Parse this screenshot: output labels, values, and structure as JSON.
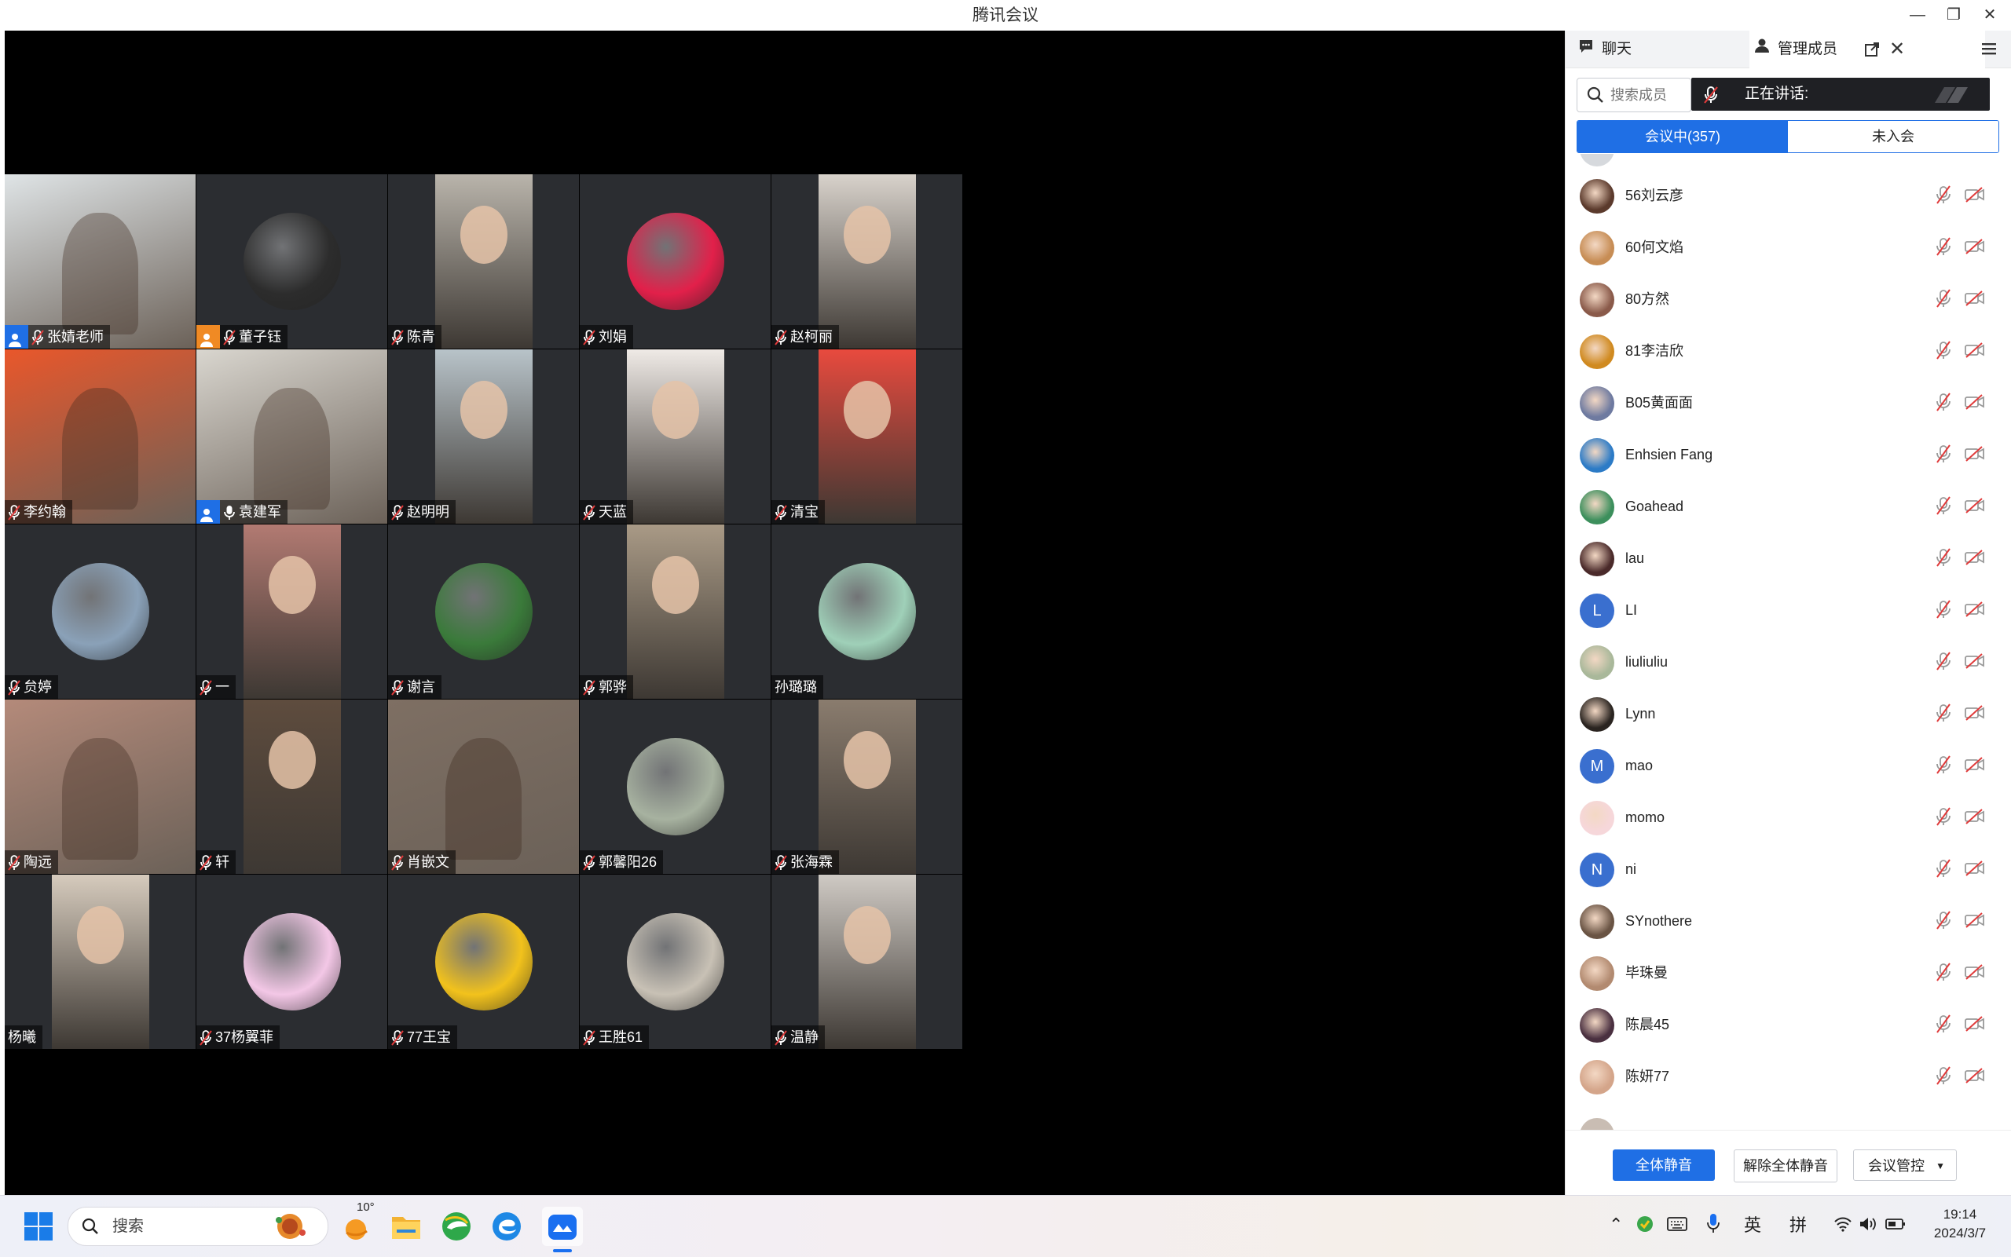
{
  "window": {
    "title": "腾讯会议"
  },
  "participants": [
    {
      "name": "张婧老师",
      "host": "blue",
      "kind": "full",
      "bg": "#dfe4e6"
    },
    {
      "name": "董子钰",
      "host": "orange",
      "kind": "avatar",
      "bg": "#2c2c2c"
    },
    {
      "name": "陈青",
      "kind": "cam",
      "bg": "#b9b4ab"
    },
    {
      "name": "刘娟",
      "kind": "avatar",
      "bg": "#e2204a"
    },
    {
      "name": "赵柯丽",
      "kind": "cam",
      "bg": "#d8d2cb"
    },
    {
      "name": "李约翰",
      "kind": "full",
      "bg": "#e9572b"
    },
    {
      "name": "袁建军",
      "host": "blue",
      "kind": "full",
      "bg": "#d9d6cf",
      "mic_on": true
    },
    {
      "name": "赵明明",
      "kind": "cam",
      "bg": "#b8c3c9"
    },
    {
      "name": "天蓝",
      "kind": "cam",
      "bg": "#efeae6"
    },
    {
      "name": "清宝",
      "kind": "cam",
      "bg": "#e84a3e"
    },
    {
      "name": "贠婷",
      "kind": "avatar",
      "bg": "#8aa1b8"
    },
    {
      "name": "一",
      "kind": "cam",
      "bg": "#b27a72"
    },
    {
      "name": "谢言",
      "kind": "avatar",
      "bg": "#3a7a3a"
    },
    {
      "name": "郭骅",
      "kind": "cam",
      "bg": "#a99a86"
    },
    {
      "name": "孙璐璐",
      "kind": "avatar",
      "bg": "#9fd0b8",
      "no_mic_icon": true
    },
    {
      "name": "陶远",
      "kind": "full",
      "bg": "#b48a7a"
    },
    {
      "name": "轩",
      "kind": "cam",
      "bg": "#5e4c3e"
    },
    {
      "name": "肖嵌文",
      "kind": "full",
      "bg": "#7e6f63"
    },
    {
      "name": "郭馨阳26",
      "kind": "avatar",
      "bg": "#a7b2a0"
    },
    {
      "name": "张海霖",
      "kind": "cam",
      "bg": "#8a7c6e"
    },
    {
      "name": "杨曦",
      "kind": "cam",
      "bg": "#d6cbbd",
      "no_mic_icon": true
    },
    {
      "name": "37杨翼菲",
      "kind": "avatar",
      "bg": "#f3c7e6"
    },
    {
      "name": "77王宝",
      "kind": "avatar",
      "bg": "#f2c21c"
    },
    {
      "name": "王胜61",
      "kind": "avatar",
      "bg": "#c8c1b5"
    },
    {
      "name": "温静",
      "kind": "cam",
      "bg": "#cfcac4"
    }
  ],
  "panel": {
    "tab_chat": "聊天",
    "tab_members": "管理成员",
    "search_placeholder": "搜索成员",
    "speaking_label": "正在讲话:",
    "seg_in_meeting": "会议中(357)",
    "seg_not_joined": "未入会",
    "members": [
      {
        "name": "56刘云彦",
        "color": "#5b3a2c"
      },
      {
        "name": "60何文焰",
        "color": "#c78d55"
      },
      {
        "name": "80方然",
        "color": "#8a5a4a"
      },
      {
        "name": "81李洁欣",
        "color": "#d08a20"
      },
      {
        "name": "B05黄面面",
        "color": "#6e7aa0"
      },
      {
        "name": "Enhsien Fang",
        "color": "#2c7bc6"
      },
      {
        "name": "Goahead",
        "color": "#3c8f5c"
      },
      {
        "name": "lau",
        "color": "#4a2a2a"
      },
      {
        "name": "LI",
        "color": "#3a6fcf",
        "initial": "L"
      },
      {
        "name": "liuliuliu",
        "color": "#a9b89a"
      },
      {
        "name": "Lynn",
        "color": "#2a2420"
      },
      {
        "name": "mao",
        "color": "#3a6fcf",
        "initial": "M"
      },
      {
        "name": "momo",
        "color": "#f6d7da"
      },
      {
        "name": "ni",
        "color": "#3a6fcf",
        "initial": "N"
      },
      {
        "name": "SYnothere",
        "color": "#6a5444"
      },
      {
        "name": "毕珠曼",
        "color": "#b28a70"
      },
      {
        "name": "陈晨45",
        "color": "#4a3040"
      },
      {
        "name": "陈妍77",
        "color": "#d4a58a"
      }
    ],
    "btn_mute_all": "全体静音",
    "btn_unmute_all": "解除全体静音",
    "btn_control": "会议管控"
  },
  "taskbar": {
    "search_label": "搜索",
    "weather_temp": "10°",
    "ime_lang": "英",
    "ime_mode": "拼",
    "time": "19:14",
    "date": "2024/3/7"
  }
}
